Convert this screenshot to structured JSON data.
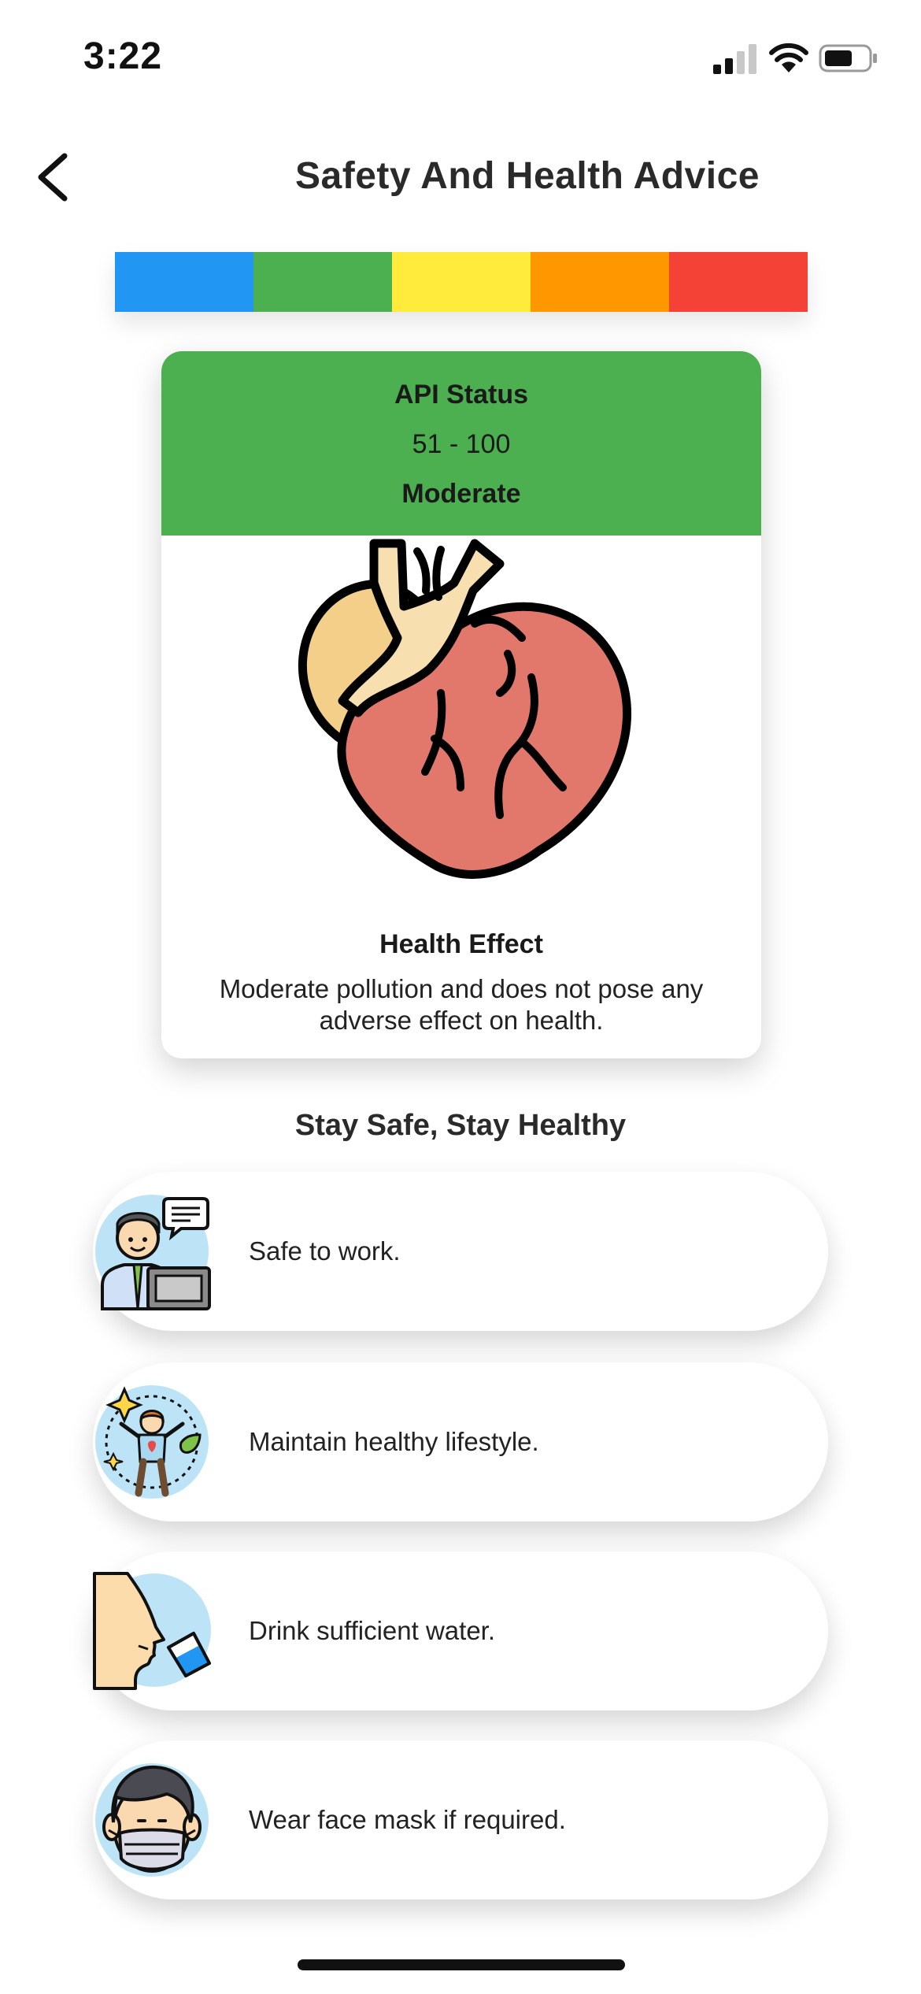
{
  "status_bar": {
    "time": "3:22"
  },
  "header": {
    "title": "Safety And Health Advice"
  },
  "aqi_scale": {
    "colors": [
      "#2196f3",
      "#4caf50",
      "#ffeb3b",
      "#ff9800",
      "#f44336"
    ]
  },
  "status_card": {
    "label": "API Status",
    "range": "51 - 100",
    "level": "Moderate",
    "header_color": "#4caf50",
    "icon": "heart-icon",
    "health_effect_title": "Health Effect",
    "health_effect_text": "Moderate pollution and does not pose any adverse effect on health."
  },
  "section": {
    "title": "Stay Safe, Stay Healthy"
  },
  "advice": [
    {
      "icon": "office-worker-icon",
      "text": "Safe to work."
    },
    {
      "icon": "healthy-person-icon",
      "text": "Maintain healthy lifestyle."
    },
    {
      "icon": "drinking-water-icon",
      "text": "Drink sufficient water."
    },
    {
      "icon": "face-mask-icon",
      "text": "Wear face mask if required."
    }
  ]
}
